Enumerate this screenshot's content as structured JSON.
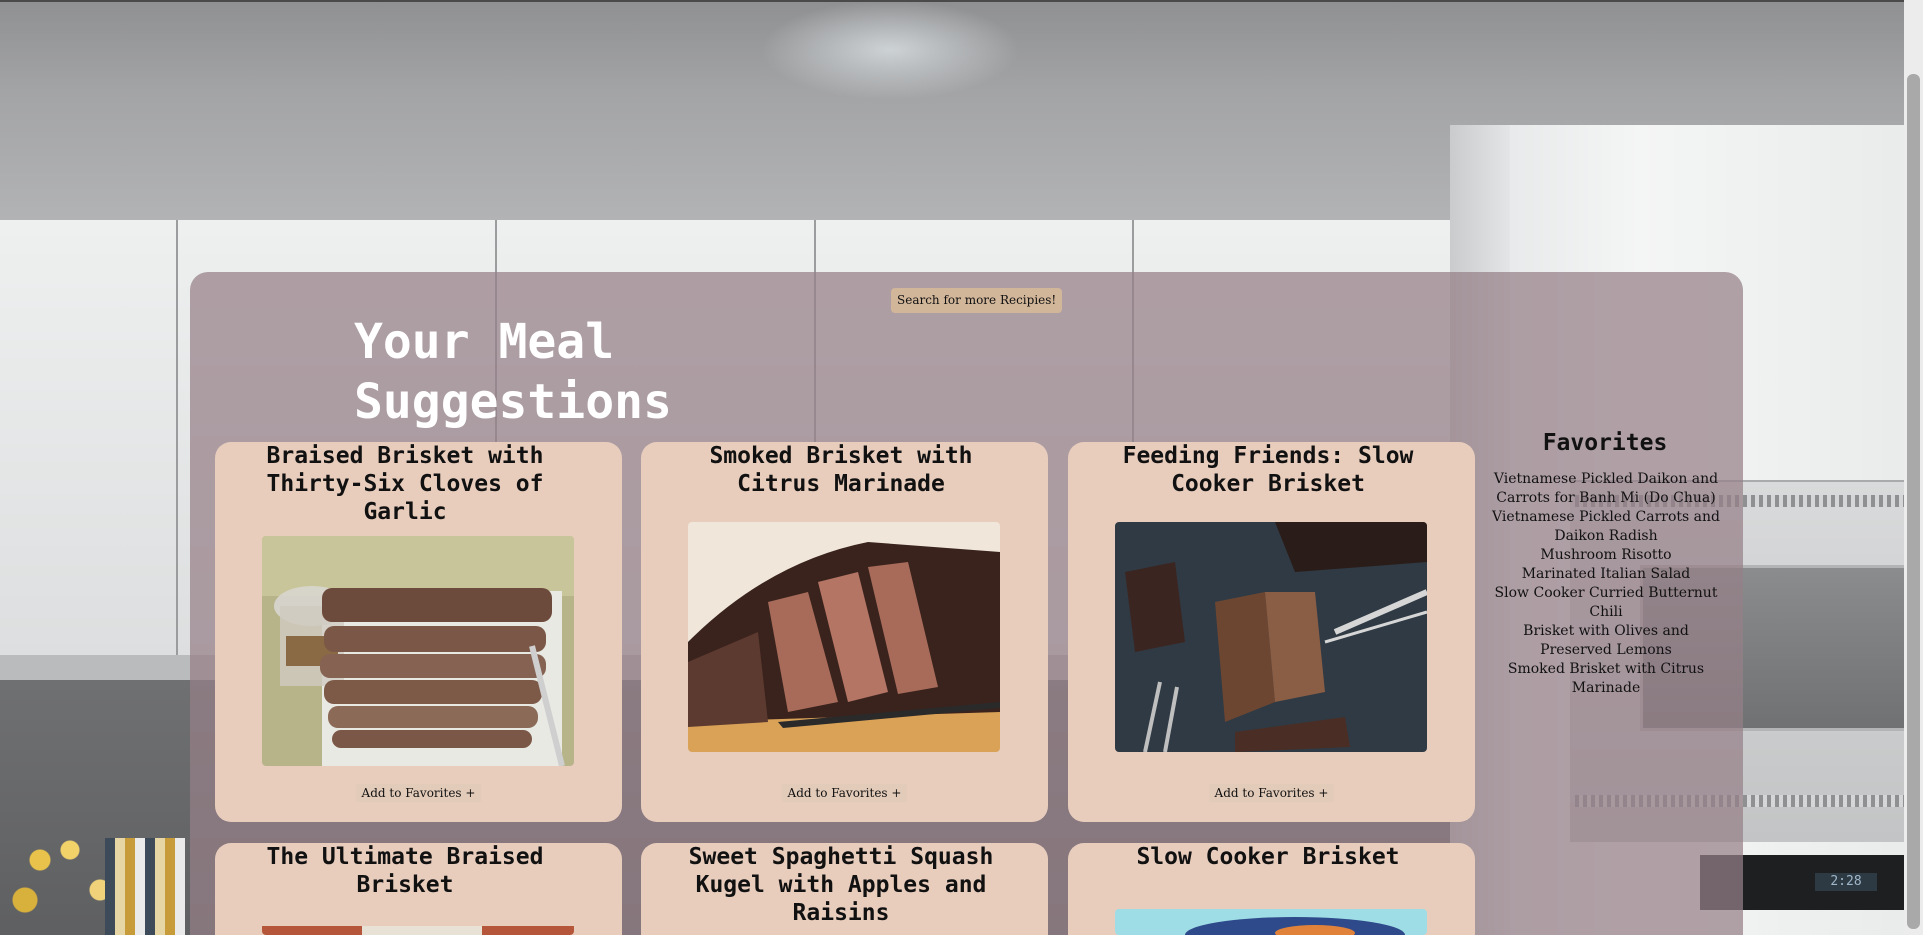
{
  "page": {
    "title": "Your Meal Suggestions",
    "search_button": "Search for more Recipies!",
    "oven_readout": "2:28"
  },
  "recipes": [
    {
      "title": "Braised Brisket with Thirty-Six Cloves of Garlic",
      "button": "Add to Favorites +",
      "image": "braised-brisket-photo"
    },
    {
      "title": "Smoked Brisket with Citrus Marinade",
      "button": "Add to Favorites +",
      "image": "smoked-brisket-photo"
    },
    {
      "title": "Feeding Friends: Slow Cooker Brisket",
      "button": "Add to Favorites +",
      "image": "slow-cooker-brisket-photo"
    },
    {
      "title": "The Ultimate Braised Brisket",
      "image": "ultimate-braised-brisket-photo"
    },
    {
      "title": "Sweet Spaghetti Squash Kugel with Apples and Raisins"
    },
    {
      "title": "Slow Cooker Brisket",
      "image": "slow-cooker-brisket-2-photo"
    }
  ],
  "favorites": {
    "title": "Favorites",
    "items": [
      "Vietnamese Pickled Daikon and Carrots for Banh Mi (Do Chua)",
      "Vietnamese Pickled Carrots and Daikon Radish",
      "Mushroom Risotto",
      "Marinated Italian Salad",
      "Slow Cooker Curried Butternut Chili",
      "Brisket with Olives and Preserved Lemons",
      "Smoked Brisket with Citrus Marinade"
    ]
  },
  "colors": {
    "panel": "#968088",
    "card": "#e8cdbd",
    "button": "#d2b69a"
  }
}
